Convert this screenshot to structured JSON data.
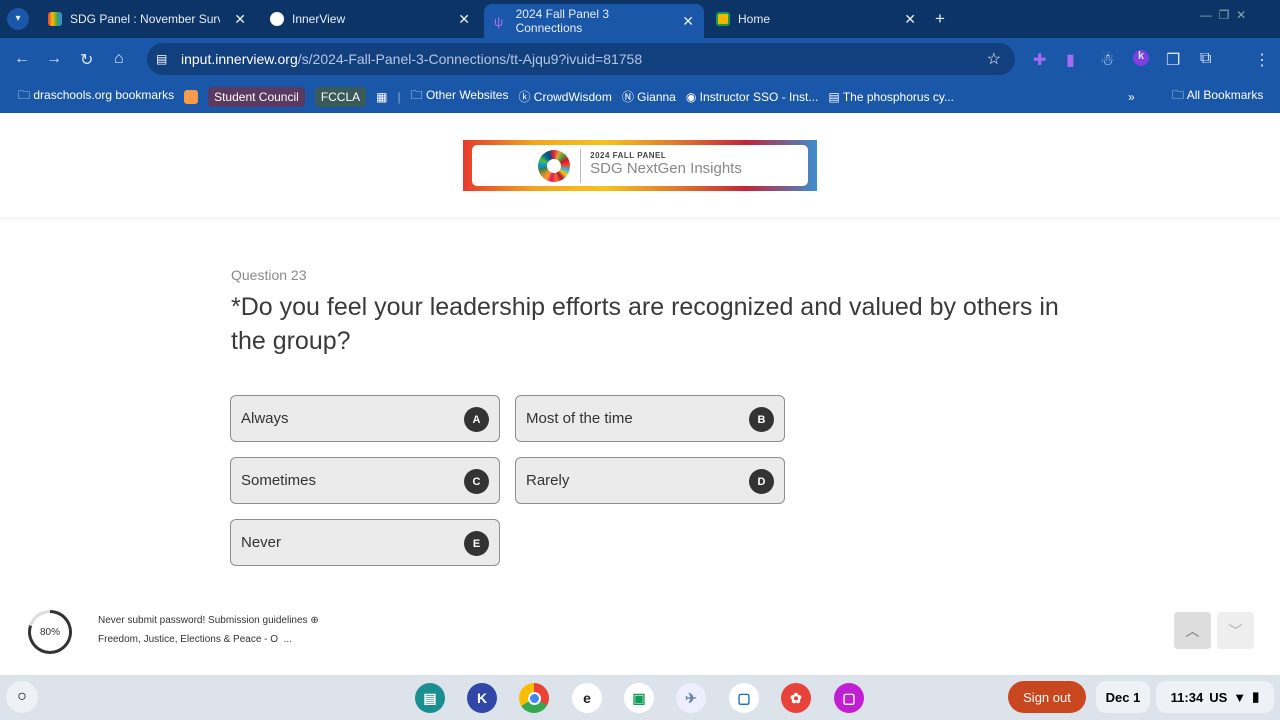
{
  "browser": {
    "tabs": [
      {
        "title": "SDG Panel : November Survey",
        "icon": "gmail-icon",
        "active": false
      },
      {
        "title": "InnerView",
        "icon": "innerview-icon",
        "active": false
      },
      {
        "title": "2024 Fall Panel 3 Connections",
        "icon": "innerview-purple-icon",
        "active": true
      },
      {
        "title": "Home",
        "icon": "classroom-icon",
        "active": false
      }
    ],
    "url_host": "input.innerview.org",
    "url_path": "/s/2024-Fall-Panel-3-Connections/tt-Ajqu9?ivuid=81758",
    "bookmarks": [
      "draschools.org bookmarks",
      "Student Council",
      "FCCLA",
      "Other Websites",
      "CrowdWisdom",
      "Gianna",
      "Instructor SSO - Inst...",
      "The phosphorus cy...",
      "All Bookmarks"
    ]
  },
  "banner": {
    "line1": "2024 FALL PANEL",
    "line2": "SDG NextGen Insights"
  },
  "question": {
    "number": "Question 23",
    "text": "*Do you feel your leadership efforts are recognized and valued by others in the group?",
    "options": [
      {
        "label": "Always",
        "key": "A"
      },
      {
        "label": "Most of the time",
        "key": "B"
      },
      {
        "label": "Sometimes",
        "key": "C"
      },
      {
        "label": "Rarely",
        "key": "D"
      },
      {
        "label": "Never",
        "key": "E"
      }
    ]
  },
  "footer": {
    "progress_percent": 80,
    "progress_label": "80%",
    "notice": "Never submit password! Submission guidelines",
    "section": "Freedom, Justice, Elections & Peace - O",
    "ellipsis": "..."
  },
  "shelf": {
    "sign_out": "Sign out",
    "date": "Dec 1",
    "time": "11:34",
    "locale": "US"
  }
}
